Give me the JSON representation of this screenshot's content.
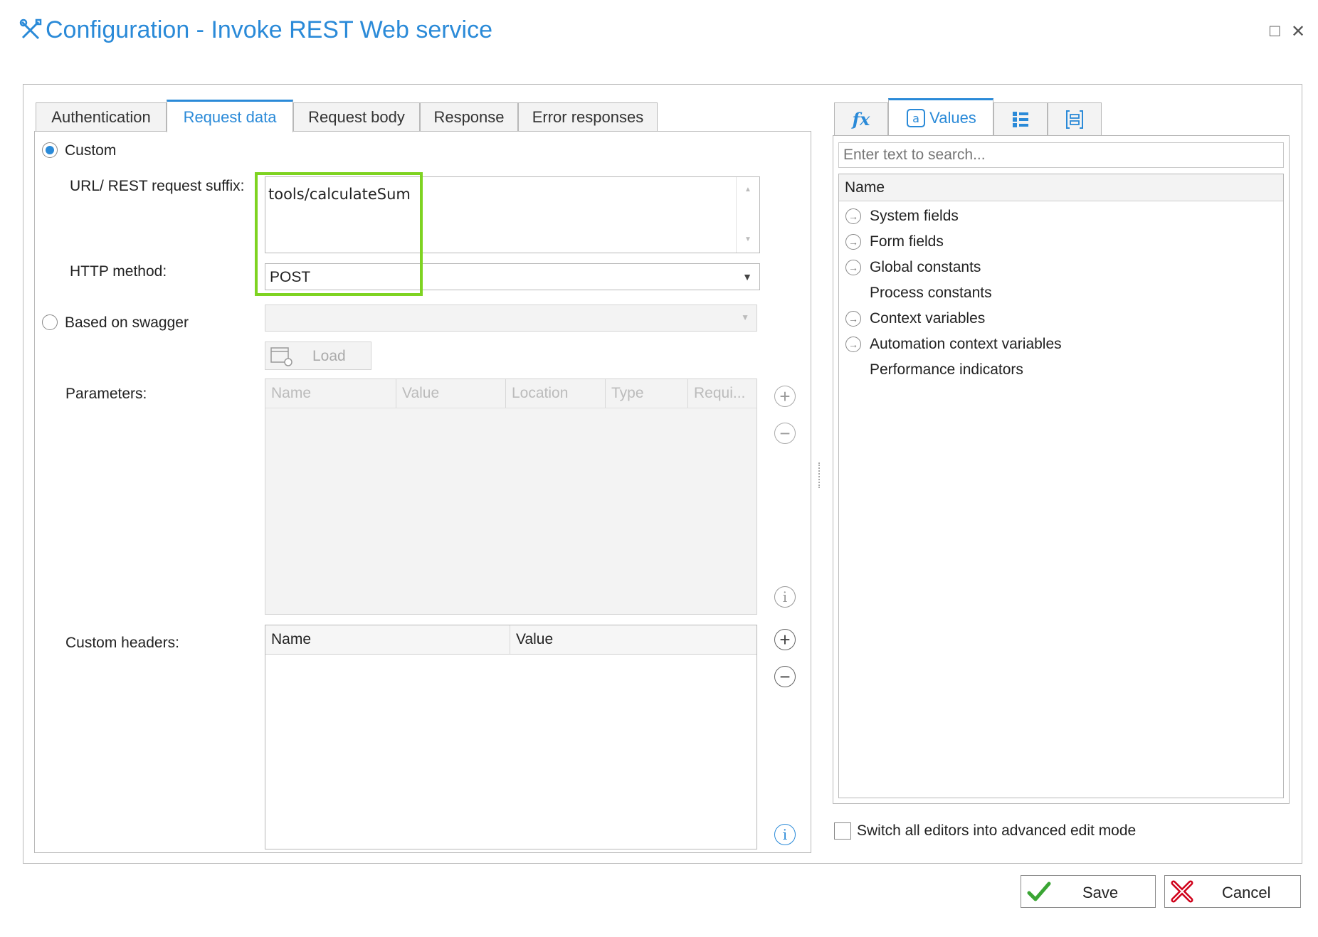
{
  "window": {
    "title": "Configuration - Invoke REST Web service",
    "maximize_glyph": "□",
    "close_glyph": "✕"
  },
  "tabs": [
    {
      "label": "Authentication"
    },
    {
      "label": "Request data"
    },
    {
      "label": "Request body"
    },
    {
      "label": "Response"
    },
    {
      "label": "Error responses"
    }
  ],
  "request": {
    "custom_label": "Custom",
    "url_label": "URL/ REST request suffix:",
    "url_value": "tools/calculateSum",
    "http_method_label": "HTTP method:",
    "http_method_value": "POST",
    "swagger_label": "Based on swagger",
    "load_label": "Load",
    "parameters_label": "Parameters:",
    "param_columns": [
      "Name",
      "Value",
      "Location",
      "Type",
      "Requi..."
    ],
    "custom_headers_label": "Custom headers:",
    "header_columns": [
      "Name",
      "Value"
    ]
  },
  "right_panel": {
    "tabs": [
      {
        "icon": "fx-icon",
        "label": "fx"
      },
      {
        "icon": "values-icon",
        "label": "Values"
      },
      {
        "icon": "list-icon",
        "label": ""
      },
      {
        "icon": "bracket-list-icon",
        "label": ""
      }
    ],
    "search_placeholder": "Enter text to search...",
    "column_header": "Name",
    "tree": [
      {
        "label": "System fields",
        "expandable": true
      },
      {
        "label": "Form fields",
        "expandable": true
      },
      {
        "label": "Global constants",
        "expandable": true
      },
      {
        "label": "Process constants",
        "expandable": false
      },
      {
        "label": "Context variables",
        "expandable": true
      },
      {
        "label": "Automation context variables",
        "expandable": true
      },
      {
        "label": "Performance indicators",
        "expandable": false
      }
    ],
    "advanced_mode_label": "Switch all editors into advanced edit mode"
  },
  "footer": {
    "save_label": "Save",
    "cancel_label": "Cancel"
  },
  "colors": {
    "accent": "#2a8ad8",
    "highlight": "#7ed321",
    "cancel": "#d0021b",
    "save": "#3aa534"
  }
}
